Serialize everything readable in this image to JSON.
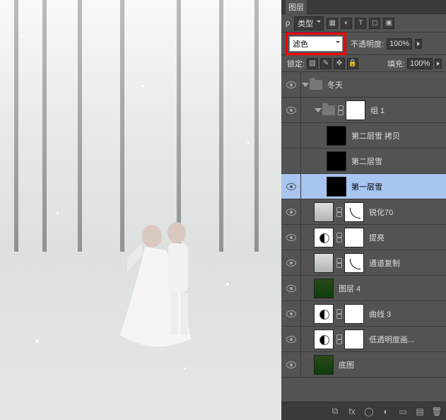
{
  "tabs": {
    "layers": "图层"
  },
  "filter": {
    "label": "类型"
  },
  "blend": {
    "mode": "滤色",
    "opacity_label": "不透明度:",
    "opacity_value": "100%",
    "fill_label": "填充:",
    "fill_value": "100%"
  },
  "lock": {
    "label": "锁定:"
  },
  "layers": [
    {
      "name": "冬天",
      "type": "group",
      "depth": 0,
      "open": true,
      "visible": true
    },
    {
      "name": "组 1",
      "type": "group",
      "depth": 1,
      "open": true,
      "visible": true
    },
    {
      "name": "第二层雪 拷贝",
      "type": "layer",
      "thumb": "black",
      "depth": 2,
      "visible": false
    },
    {
      "name": "第二层雪",
      "type": "layer",
      "thumb": "black",
      "depth": 2,
      "visible": false
    },
    {
      "name": "第一层雪",
      "type": "layer",
      "thumb": "black",
      "depth": 2,
      "visible": true,
      "selected": true
    },
    {
      "name": "锐化70",
      "type": "masked",
      "thumb": "img",
      "mask": "mask-curve",
      "depth": 1,
      "visible": true
    },
    {
      "name": "提亮",
      "type": "masked",
      "thumb": "adj",
      "mask": "white",
      "depth": 1,
      "visible": true
    },
    {
      "name": "通道复制",
      "type": "masked",
      "thumb": "img",
      "mask": "mask-curve",
      "depth": 1,
      "visible": true
    },
    {
      "name": "图层 4",
      "type": "layer",
      "thumb": "green",
      "depth": 1,
      "visible": true
    },
    {
      "name": "曲线 3",
      "type": "masked",
      "thumb": "adj",
      "mask": "white",
      "depth": 1,
      "visible": true
    },
    {
      "name": "低透明度画...",
      "type": "masked",
      "thumb": "adj",
      "mask": "white",
      "depth": 1,
      "visible": true
    },
    {
      "name": "底图",
      "type": "layer",
      "thumb": "green",
      "depth": 1,
      "visible": true
    }
  ]
}
